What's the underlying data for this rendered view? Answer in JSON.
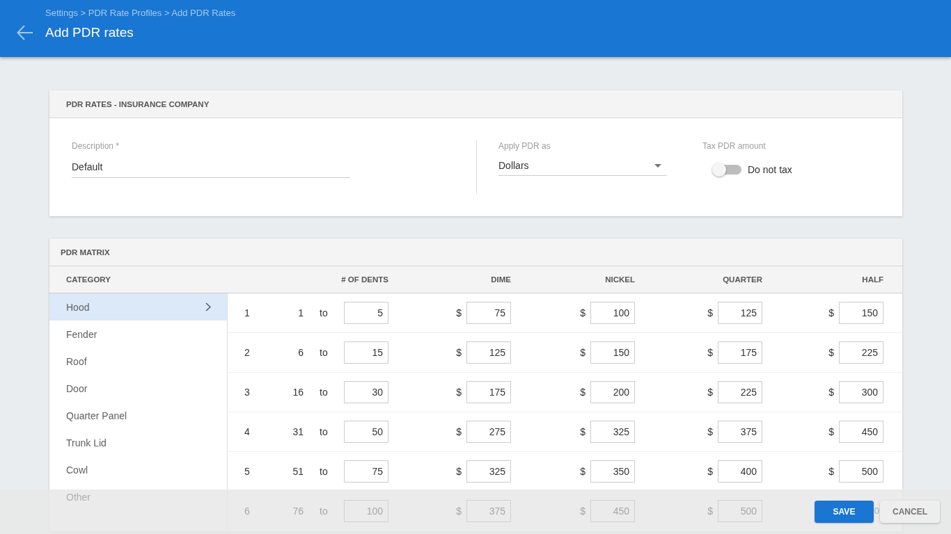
{
  "header": {
    "breadcrumb": "Settings > PDR Rate Profiles > Add PDR Rates",
    "title": "Add PDR rates"
  },
  "rates_card": {
    "title": "PDR RATES - INSURANCE COMPANY",
    "description": {
      "label": "Description *",
      "value": "Default"
    },
    "apply_as": {
      "label": "Apply PDR as",
      "value": "Dollars"
    },
    "tax": {
      "label": "Tax PDR amount",
      "on": false,
      "text": "Do not tax"
    }
  },
  "matrix": {
    "title": "PDR MATRIX",
    "category_heading": "CATEGORY",
    "columns": [
      "# OF DENTS",
      "DIME",
      "NICKEL",
      "QUARTER",
      "HALF"
    ],
    "categories": [
      {
        "label": "Hood",
        "selected": true
      },
      {
        "label": "Fender",
        "selected": false
      },
      {
        "label": "Roof",
        "selected": false
      },
      {
        "label": "Door",
        "selected": false
      },
      {
        "label": "Quarter Panel",
        "selected": false
      },
      {
        "label": "Trunk Lid",
        "selected": false
      },
      {
        "label": "Cowl",
        "selected": false
      },
      {
        "label": "Other",
        "selected": false
      }
    ],
    "rows": [
      {
        "number": "1",
        "from": "1",
        "to_word": "to",
        "to": "5",
        "prices": [
          {
            "kind": "field",
            "symbol": "$",
            "value": "75"
          },
          {
            "kind": "field",
            "symbol": "$",
            "value": "100"
          },
          {
            "kind": "field",
            "symbol": "$",
            "value": "125"
          },
          {
            "kind": "field",
            "symbol": "$",
            "value": "150"
          }
        ]
      },
      {
        "number": "2",
        "from": "6",
        "to_word": "to",
        "to": "15",
        "prices": [
          {
            "kind": "field",
            "symbol": "$",
            "value": "125"
          },
          {
            "kind": "field",
            "symbol": "$",
            "value": "150"
          },
          {
            "kind": "field",
            "symbol": "$",
            "value": "175"
          },
          {
            "kind": "field",
            "symbol": "$",
            "value": "225"
          }
        ]
      },
      {
        "number": "3",
        "from": "16",
        "to_word": "to",
        "to": "30",
        "prices": [
          {
            "kind": "field",
            "symbol": "$",
            "value": "175"
          },
          {
            "kind": "field",
            "symbol": "$",
            "value": "200"
          },
          {
            "kind": "field",
            "symbol": "$",
            "value": "225"
          },
          {
            "kind": "field",
            "symbol": "$",
            "value": "300"
          }
        ]
      },
      {
        "number": "4",
        "from": "31",
        "to_word": "to",
        "to": "50",
        "prices": [
          {
            "kind": "field",
            "symbol": "$",
            "value": "275"
          },
          {
            "kind": "field",
            "symbol": "$",
            "value": "325"
          },
          {
            "kind": "field",
            "symbol": "$",
            "value": "375"
          },
          {
            "kind": "field",
            "symbol": "$",
            "value": "450"
          }
        ]
      },
      {
        "number": "5",
        "from": "51",
        "to_word": "to",
        "to": "75",
        "prices": [
          {
            "kind": "field",
            "symbol": "$",
            "value": "325"
          },
          {
            "kind": "field",
            "symbol": "$",
            "value": "350"
          },
          {
            "kind": "field",
            "symbol": "$",
            "value": "400"
          },
          {
            "kind": "field",
            "symbol": "$",
            "value": "500"
          }
        ]
      },
      {
        "number": "6",
        "from": "76",
        "to_word": "to",
        "to": "100",
        "prices": [
          {
            "kind": "field",
            "symbol": "$",
            "value": "375"
          },
          {
            "kind": "field",
            "symbol": "$",
            "value": "450"
          },
          {
            "kind": "field",
            "symbol": "$",
            "value": "500"
          },
          {
            "kind": "fragment",
            "value": "0"
          }
        ]
      }
    ]
  },
  "actions": [
    {
      "label": "SAVE",
      "kind": "primary"
    },
    {
      "label": "CANCEL",
      "kind": "secondary"
    }
  ]
}
